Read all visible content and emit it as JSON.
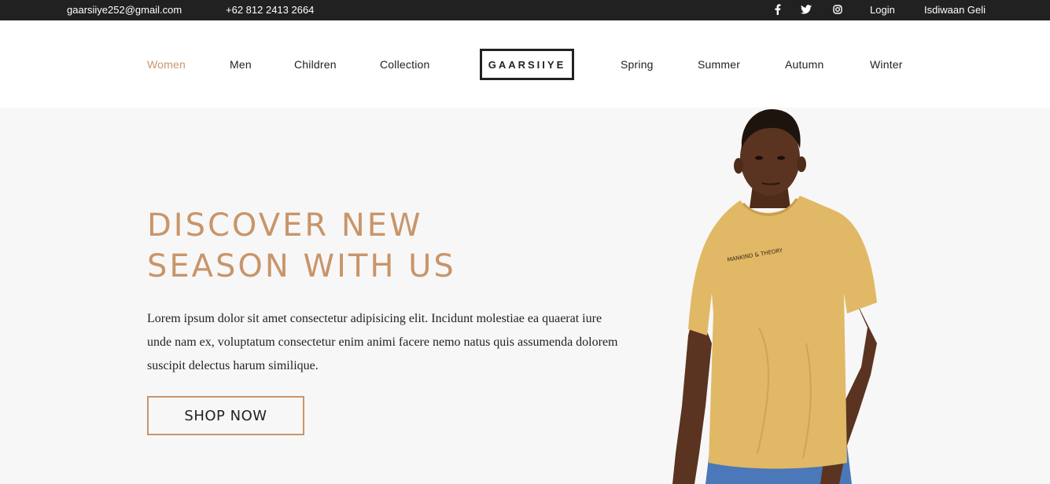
{
  "topbar": {
    "email": "gaarsiiye252@gmail.com",
    "phone": "+62 812 2413 2664",
    "social_icons": [
      "facebook-icon",
      "twitter-icon",
      "instagram-icon"
    ],
    "login_label": "Login",
    "register_label": "Isdiwaan Geli"
  },
  "nav": {
    "left_links": [
      {
        "label": "Women",
        "active": true
      },
      {
        "label": "Men"
      },
      {
        "label": "Children"
      },
      {
        "label": "Collection"
      }
    ],
    "logo": "GAARSIIYE",
    "right_links": [
      {
        "label": "Spring"
      },
      {
        "label": "Summer"
      },
      {
        "label": "Autumn"
      },
      {
        "label": "Winter"
      }
    ]
  },
  "hero": {
    "title_line1": "DISCOVER NEW",
    "title_line2": "SEASON WITH US",
    "description": "Lorem ipsum dolor sit amet consectetur adipisicing elit. Incidunt molestiae ea quaerat iure unde nam ex, voluptatum consectetur enim animi facere nemo natus quis assumenda dolorem suscipit delectus harum similique.",
    "cta_label": "SHOP NOW",
    "shirt_print": "MANKIND & THEORY"
  },
  "colors": {
    "accent": "#c8956a",
    "topbar_bg": "#212121",
    "hero_bg": "#f8f7f7",
    "shirt": "#e1b865",
    "skin": "#5a3420",
    "jeans": "#4a78b8"
  }
}
